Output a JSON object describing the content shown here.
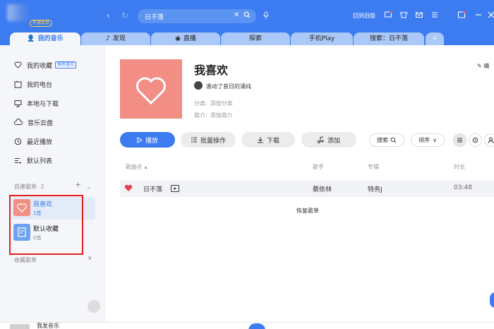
{
  "header": {
    "vip_badge": "开通会员",
    "search_value": "日不落",
    "back_to_old": "回到旧版"
  },
  "tabs": [
    {
      "label": "我的音乐"
    },
    {
      "label": "发现"
    },
    {
      "label": "直播"
    },
    {
      "label": "探索"
    },
    {
      "label": "手机Play"
    },
    {
      "label": "搜索：日不落"
    },
    {
      "label": "+"
    }
  ],
  "sidebar": {
    "items": [
      {
        "label": "我的收藏",
        "tag": "推荐喜欢"
      },
      {
        "label": "我的电台"
      },
      {
        "label": "本地与下载"
      },
      {
        "label": "音乐云盘"
      },
      {
        "label": "最近播放"
      },
      {
        "label": "默认列表"
      }
    ],
    "created_header": "自建歌单",
    "created_count": "2",
    "playlists": [
      {
        "name": "我喜欢",
        "count": "1首"
      },
      {
        "name": "默认收藏",
        "count": "0首"
      }
    ],
    "collected_header": "收藏歌单"
  },
  "playlist": {
    "title": "我喜欢",
    "owner": "進动了昔日的涌纯",
    "category_label": "分类:",
    "category_value": "添加分类",
    "intro_label": "简介:",
    "intro_value": "添加简介",
    "edit": "编"
  },
  "actions": {
    "play": "播放",
    "batch": "批量操作",
    "download": "下载",
    "add": "添加",
    "search": "搜索",
    "sort": "排序"
  },
  "table": {
    "headers": [
      "歌曲名",
      "歌手",
      "专辑",
      "时长"
    ],
    "rows": [
      {
        "title": "日不落",
        "artist": "蔡依林",
        "album": "特务J",
        "duration": "03:48"
      }
    ],
    "restore": "恢复歌单"
  },
  "player": {
    "title": "我发音乐"
  },
  "colors": {
    "accent": "#3c7cf0",
    "heart": "#e0454c",
    "cover": "#f28e84",
    "highlight_box": "#e02020"
  }
}
